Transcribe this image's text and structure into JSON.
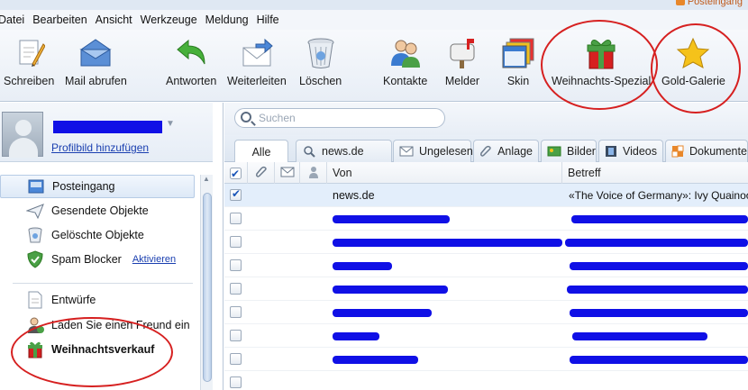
{
  "window": {
    "title": "Posteingang"
  },
  "menu": [
    "Datei",
    "Bearbeiten",
    "Ansicht",
    "Werkzeuge",
    "Meldung",
    "Hilfe"
  ],
  "toolbar": {
    "schreiben": "Schreiben",
    "mail_abrufen": "Mail abrufen",
    "antworten": "Antworten",
    "weiterleiten": "Weiterleiten",
    "loeschen": "Löschen",
    "kontakte": "Kontakte",
    "melder": "Melder",
    "skin": "Skin",
    "weihnachts": "Weihnachts-Spezial",
    "gold": "Gold-Galerie"
  },
  "profile": {
    "add_picture": "Profilbild hinzufügen"
  },
  "folders": {
    "posteingang": "Posteingang",
    "gesendete": "Gesendete Objekte",
    "geloeschte": "Gelöschte Objekte",
    "spam": "Spam Blocker",
    "spam_action": "Aktivieren",
    "entwuerfe": "Entwürfe",
    "freund": "Laden Sie einen Freund ein",
    "weihnachtsverkauf": "Weihnachtsverkauf"
  },
  "search": {
    "placeholder": "Suchen"
  },
  "tabs": {
    "alle": "Alle",
    "newsde": "news.de",
    "ungelesen": "Ungelesen",
    "anlage": "Anlage",
    "bilder": "Bilder",
    "videos": "Videos",
    "dokumente": "Dokumente"
  },
  "columns": {
    "from": "Von",
    "subject": "Betreff"
  },
  "messages": {
    "m0": {
      "from": "news.de",
      "subject": "«The Voice of Germany»: Ivy Quainoo"
    }
  },
  "colors": {
    "accent": "#1a3fb0",
    "annotation": "#d62020",
    "redaction": "#1010e6"
  }
}
